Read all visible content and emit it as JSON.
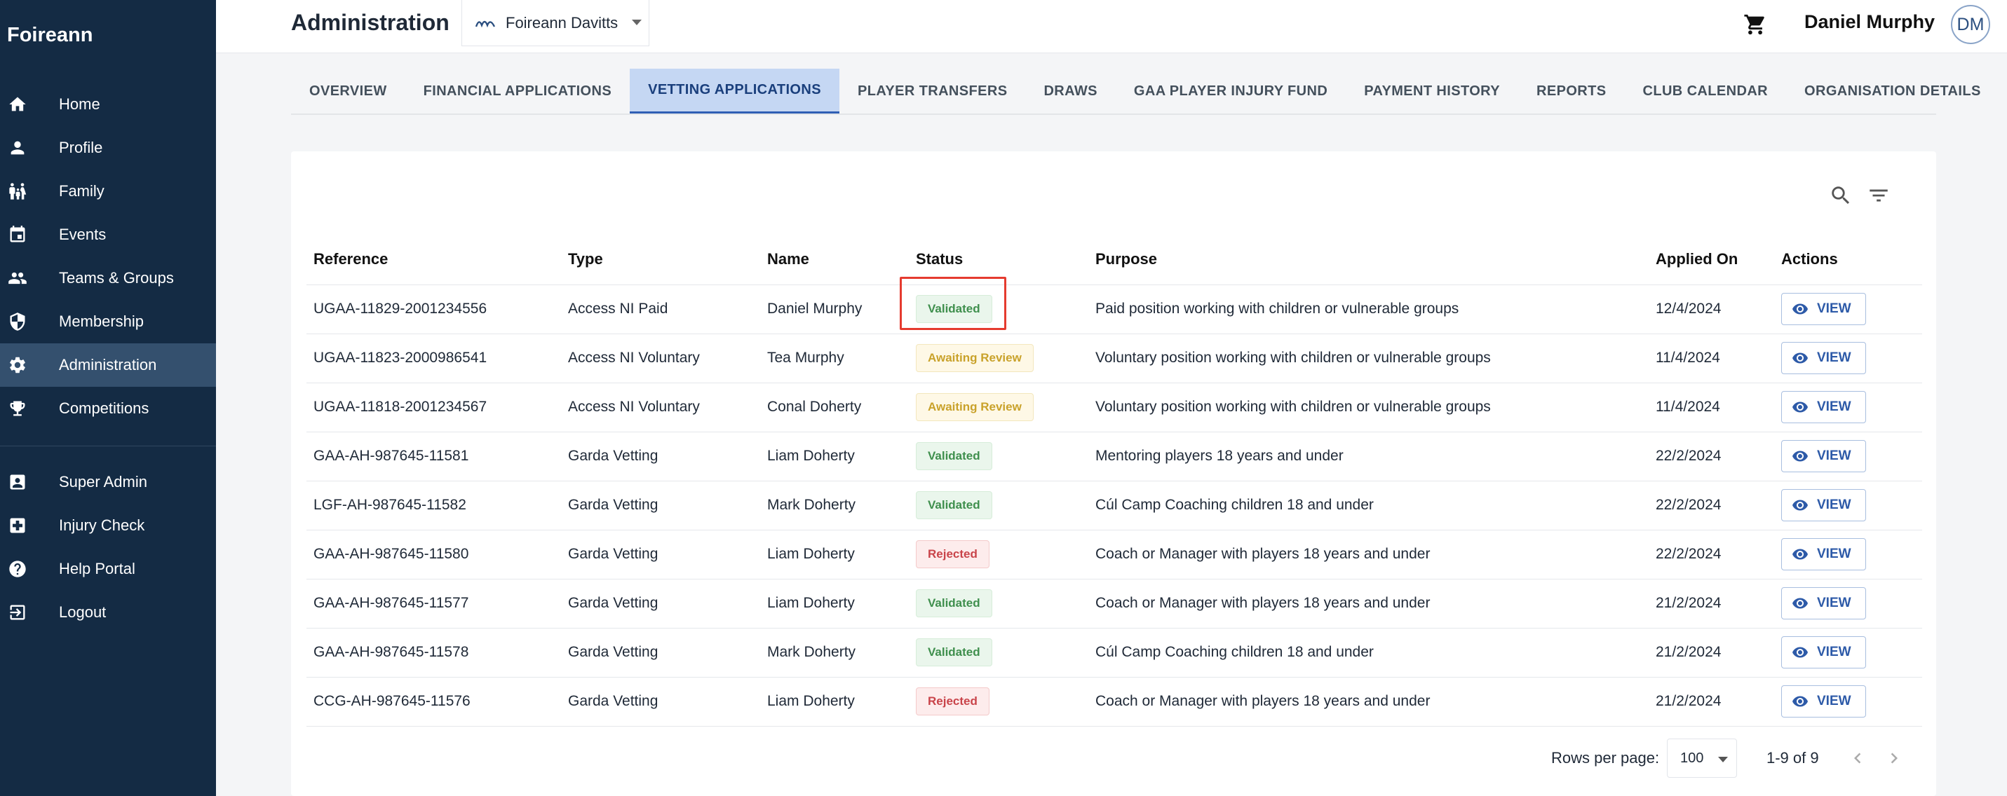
{
  "brand": "Foireann",
  "sidebar": {
    "items": [
      {
        "label": "Home",
        "icon": "home-icon"
      },
      {
        "label": "Profile",
        "icon": "person-icon"
      },
      {
        "label": "Family",
        "icon": "family-icon"
      },
      {
        "label": "Events",
        "icon": "calendar-icon"
      },
      {
        "label": "Teams & Groups",
        "icon": "group-icon"
      },
      {
        "label": "Membership",
        "icon": "shield-icon"
      },
      {
        "label": "Administration",
        "icon": "gear-icon",
        "active": true
      },
      {
        "label": "Competitions",
        "icon": "trophy-icon"
      }
    ],
    "secondary": [
      {
        "label": "Super Admin",
        "icon": "admin-icon"
      },
      {
        "label": "Injury Check",
        "icon": "medical-icon"
      },
      {
        "label": "Help Portal",
        "icon": "help-icon"
      },
      {
        "label": "Logout",
        "icon": "logout-icon"
      }
    ]
  },
  "header": {
    "title": "Administration",
    "club": "Foireann Davitts",
    "user_name": "Daniel Murphy",
    "avatar_initials": "DM"
  },
  "tabs": [
    {
      "label": "OVERVIEW"
    },
    {
      "label": "FINANCIAL APPLICATIONS"
    },
    {
      "label": "VETTING APPLICATIONS",
      "active": true
    },
    {
      "label": "PLAYER TRANSFERS"
    },
    {
      "label": "DRAWS"
    },
    {
      "label": "GAA PLAYER INJURY FUND"
    },
    {
      "label": "PAYMENT HISTORY"
    },
    {
      "label": "REPORTS"
    },
    {
      "label": "CLUB CALENDAR"
    },
    {
      "label": "ORGANISATION DETAILS"
    }
  ],
  "table": {
    "columns": [
      "Reference",
      "Type",
      "Name",
      "Status",
      "Purpose",
      "Applied On",
      "Actions"
    ],
    "view_label": "VIEW",
    "rows": [
      {
        "reference": "UGAA-11829-2001234556",
        "type": "Access NI Paid",
        "name": "Daniel Murphy",
        "status": "Validated",
        "purpose": "Paid position working with children or vulnerable groups",
        "applied_on": "12/4/2024"
      },
      {
        "reference": "UGAA-11823-2000986541",
        "type": "Access NI Voluntary",
        "name": "Tea Murphy",
        "status": "Awaiting Review",
        "purpose": "Voluntary position working with children or vulnerable groups",
        "applied_on": "11/4/2024"
      },
      {
        "reference": "UGAA-11818-2001234567",
        "type": "Access NI Voluntary",
        "name": "Conal Doherty",
        "status": "Awaiting Review",
        "purpose": "Voluntary position working with children or vulnerable groups",
        "applied_on": "11/4/2024"
      },
      {
        "reference": "GAA-AH-987645-11581",
        "type": "Garda Vetting",
        "name": "Liam Doherty",
        "status": "Validated",
        "purpose": "Mentoring players 18 years and under",
        "applied_on": "22/2/2024"
      },
      {
        "reference": "LGF-AH-987645-11582",
        "type": "Garda Vetting",
        "name": "Mark Doherty",
        "status": "Validated",
        "purpose": "Cúl Camp Coaching children 18 and under",
        "applied_on": "22/2/2024"
      },
      {
        "reference": "GAA-AH-987645-11580",
        "type": "Garda Vetting",
        "name": "Liam Doherty",
        "status": "Rejected",
        "purpose": "Coach or Manager with players 18 years and under",
        "applied_on": "22/2/2024"
      },
      {
        "reference": "GAA-AH-987645-11577",
        "type": "Garda Vetting",
        "name": "Liam Doherty",
        "status": "Validated",
        "purpose": "Coach or Manager with players 18 years and under",
        "applied_on": "21/2/2024"
      },
      {
        "reference": "GAA-AH-987645-11578",
        "type": "Garda Vetting",
        "name": "Mark Doherty",
        "status": "Validated",
        "purpose": "Cúl Camp Coaching children 18 and under",
        "applied_on": "21/2/2024"
      },
      {
        "reference": "CCG-AH-987645-11576",
        "type": "Garda Vetting",
        "name": "Liam Doherty",
        "status": "Rejected",
        "purpose": "Coach or Manager with players 18 years and under",
        "applied_on": "21/2/2024"
      }
    ]
  },
  "pagination": {
    "rows_per_page_label": "Rows per page:",
    "rows_per_page": "100",
    "range": "1-9 of 9"
  }
}
